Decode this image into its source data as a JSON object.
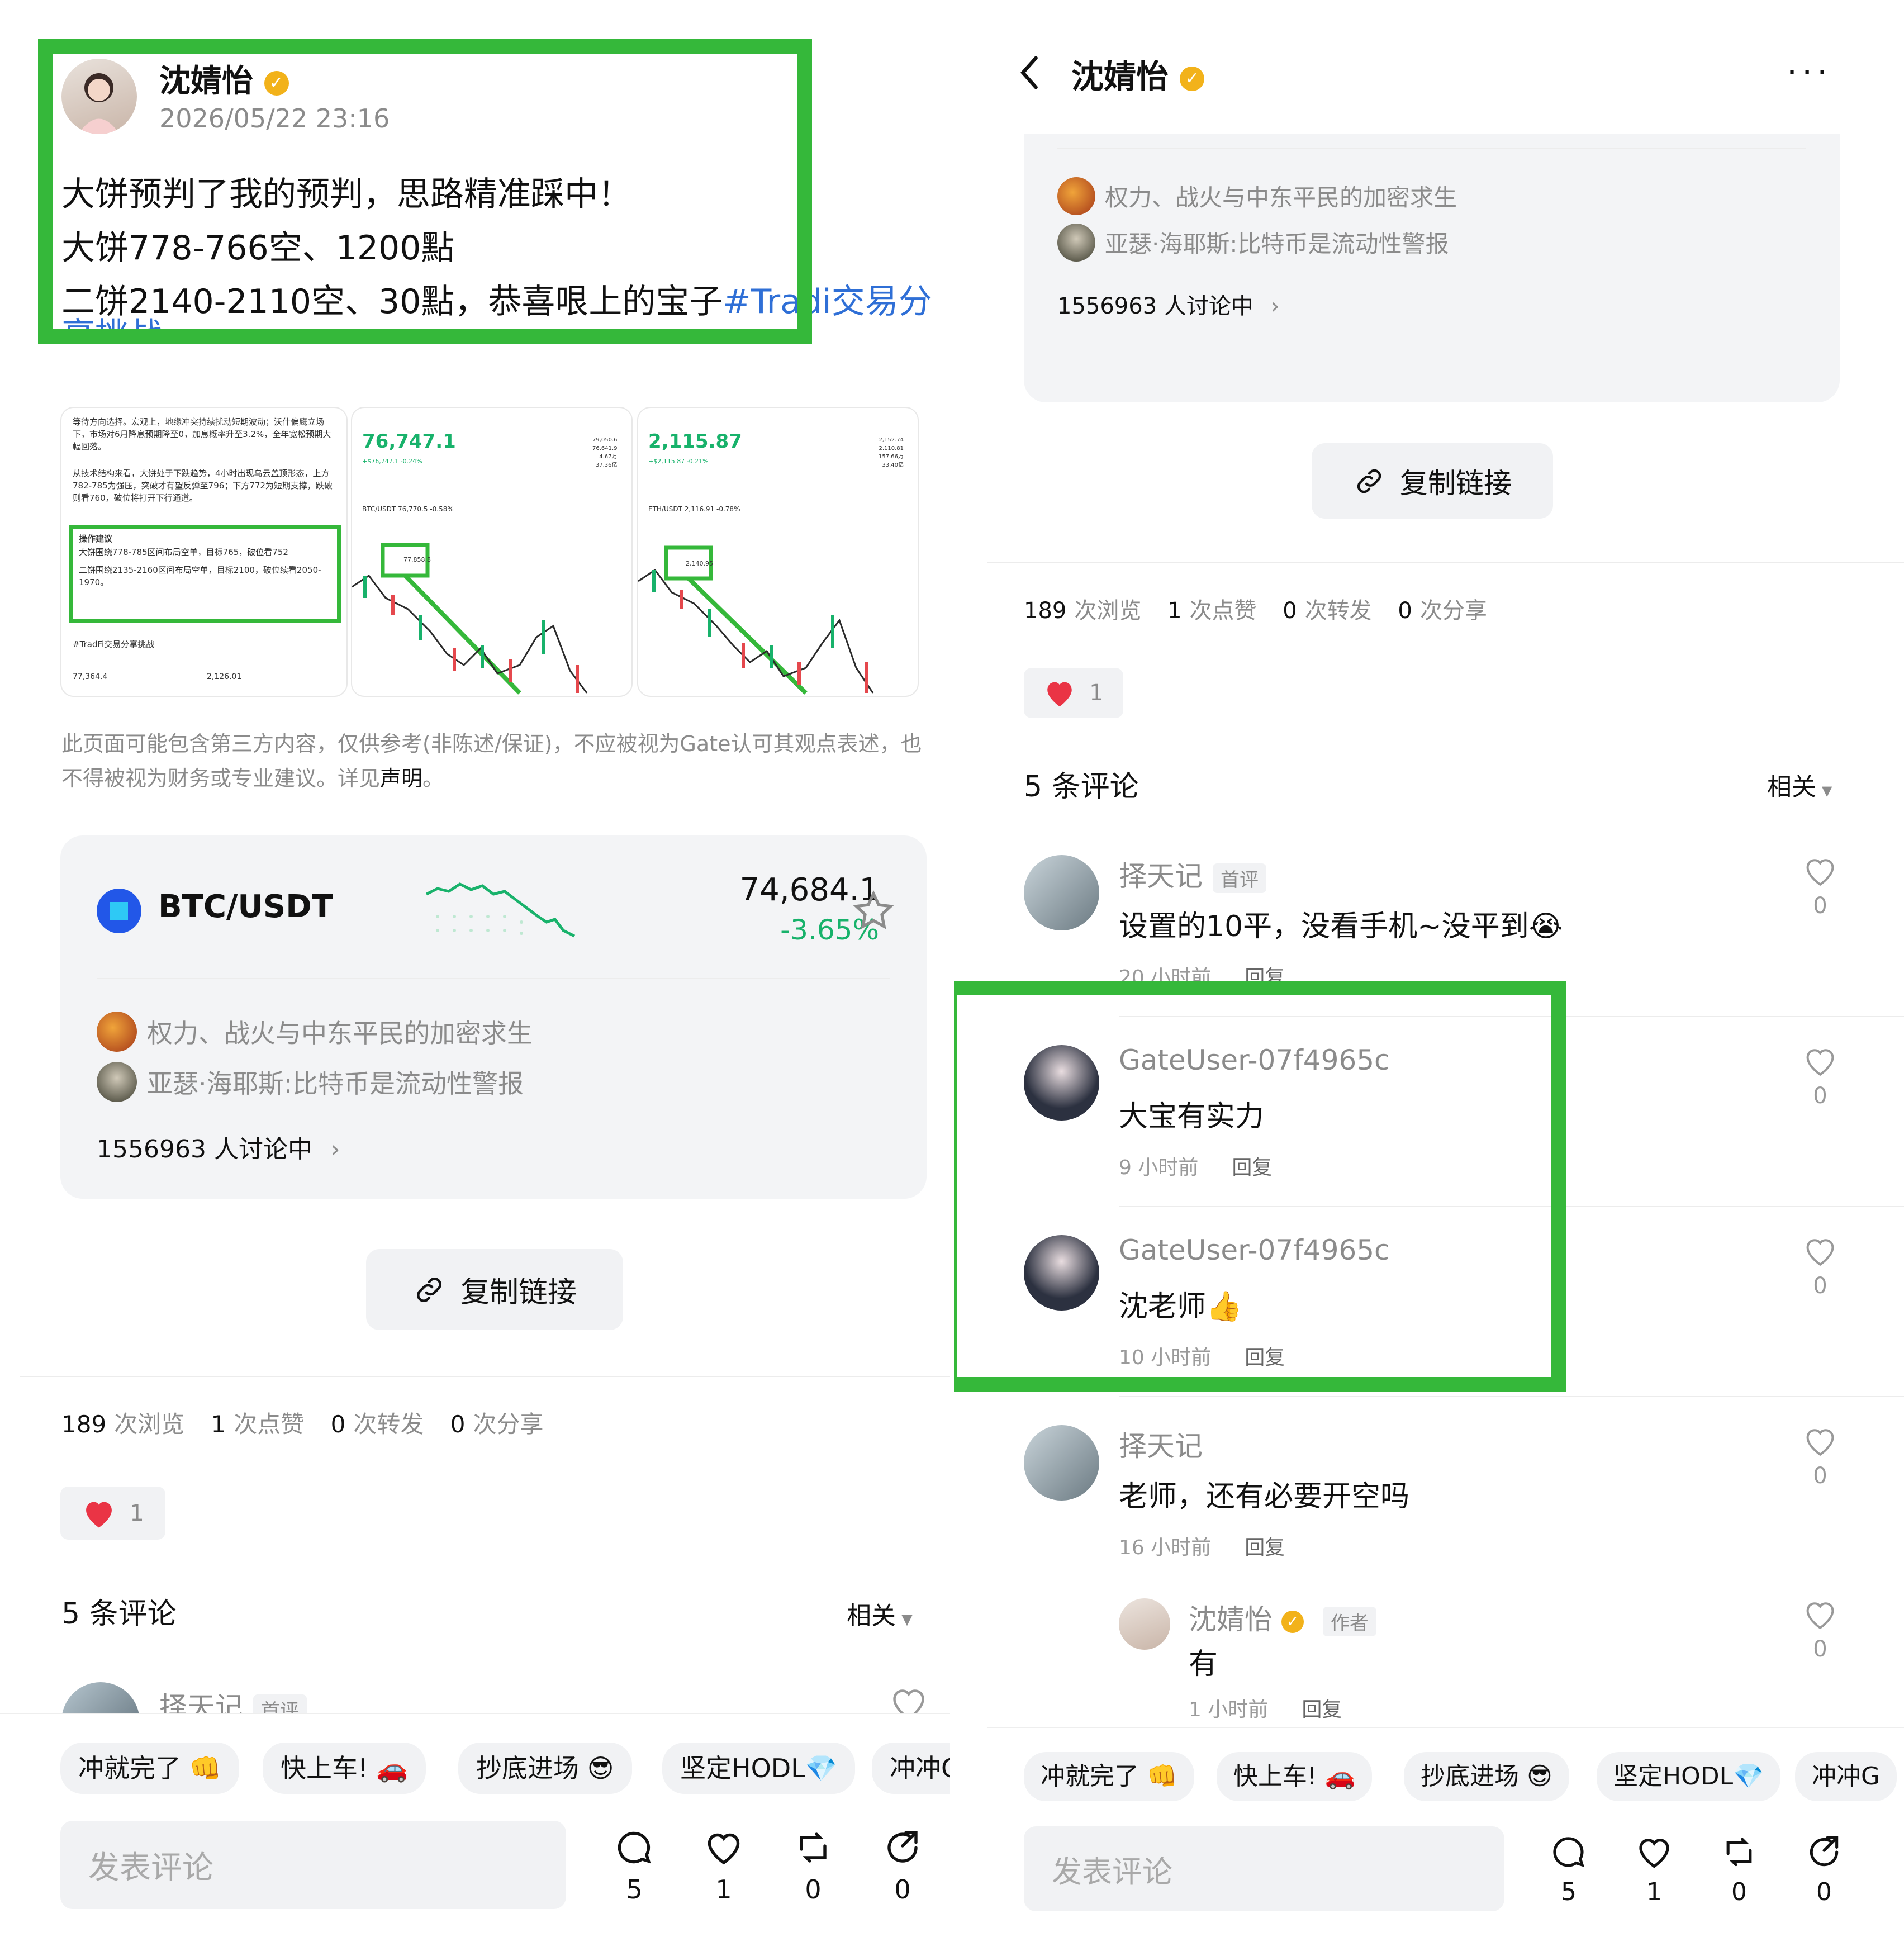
{
  "author": {
    "name": "沈婧怡",
    "timestamp": "2026/05/22 23:16",
    "author_tag": "作者"
  },
  "post": {
    "line1": "大饼预判了我的预判，思路精准踩中！",
    "line2": "大饼778-766空、1200點",
    "line3_text": "二饼2140-2110空、30點，恭喜哏上的宝子",
    "hashtag_a": "#Trad",
    "hashtag_b": "i交易分",
    "hashtag_wrap": "享挑战"
  },
  "thumbnails": {
    "t1": {
      "p1": "等待方向选择。宏观上，地缘冲突持续扰动短期波动；沃什偏鹰立场下，市场对6月降息预期降至0，加息概率升至3.2%，全年宽松预期大幅回落。",
      "p2": "从技术结构来看，大饼处于下跌趋势，4小时出现乌云盖顶形态，上方782-785为强压，突破才有望反弹至796；下方772为短期支撑，跌破则看760，破位将打开下行通道。",
      "box_title": "操作建议",
      "box_1": "大饼围绕778-785区间布局空单，目标765，破位看752",
      "box_2": "二饼围绕2135-2160区间布局空单，目标2100，破位续看2050-1970。",
      "tag": "#TradFi交易分享挑战",
      "price_a": "77,364.4",
      "price_b": "2,126.01"
    },
    "t2": {
      "price": "76,747.1",
      "change": "+$76,747.1  -0.24%",
      "pair": "BTC/USDT  76,770.5  -0.58%",
      "box_label": "77,858.8",
      "stats": [
        "79,050.6",
        "76,641.9",
        "4.67万",
        "37.36亿"
      ]
    },
    "t3": {
      "price": "2,115.87",
      "change": "+$2,115.87  -0.21%",
      "pair": "ETH/USDT  2,116.91  -0.78%",
      "box_label": "2,140.95",
      "stats": [
        "2,152.74",
        "2,110.81",
        "157.66万",
        "33.40亿"
      ]
    }
  },
  "disclaimer": {
    "text": "此页面可能包含第三方内容，仅供参考(非陈述/保证)，不应被视为Gate认可其观点表述，也不得被视为财务或专业建议。详见",
    "link": "声明",
    "end": "。"
  },
  "ticker": {
    "pair": "BTC/USDT",
    "price": "74,684.1",
    "change": "-3.65%",
    "topic1": "权力、战火与中东平民的加密求生",
    "topic2": "亚瑟·海耶斯:比特币是流动性警报",
    "discussing": "1556963 人讨论中"
  },
  "copy_link": "复制链接",
  "stats": {
    "views": "189",
    "views_label": "次浏览",
    "likes": "1",
    "likes_label": "次点赞",
    "reposts": "0",
    "reposts_label": "次转发",
    "shares": "0",
    "shares_label": "次分享"
  },
  "like_pill_count": "1",
  "comments_header": {
    "title": "5 条评论",
    "sort": "相关"
  },
  "comments": [
    {
      "name": "择天记",
      "tag": "首评",
      "text": "设置的10平，没看手机~没平到😭",
      "time": "20 小时前",
      "reply": "回复",
      "likes": "0"
    },
    {
      "name": "GateUser-07f4965c",
      "text": "大宝有实力",
      "time": "9 小时前",
      "reply": "回复",
      "likes": "0"
    },
    {
      "name": "GateUser-07f4965c",
      "text": "沈老师👍",
      "time": "10 小时前",
      "reply": "回复",
      "likes": "0"
    },
    {
      "name": "择天记",
      "text": "老师，还有必要开空吗",
      "time": "16 小时前",
      "reply": "回复",
      "likes": "0"
    },
    {
      "name": "沈婧怡",
      "tag": "作者",
      "text": "有",
      "time": "1 小时前",
      "reply": "回复",
      "likes": "0"
    }
  ],
  "quick_replies": [
    "冲就完了 👊",
    "快上车! 🚗",
    "抄底进场 😎",
    "坚定HODL💎",
    "冲冲G"
  ],
  "input_placeholder": "发表评论",
  "action_counts": {
    "comments": "5",
    "likes": "1",
    "reposts": "0",
    "shares": "0"
  },
  "colors": {
    "highlight_green": "#35b83a",
    "price_down": "#18b26b",
    "hashtag": "#2f6fd6",
    "verified": "#f2b21a"
  }
}
